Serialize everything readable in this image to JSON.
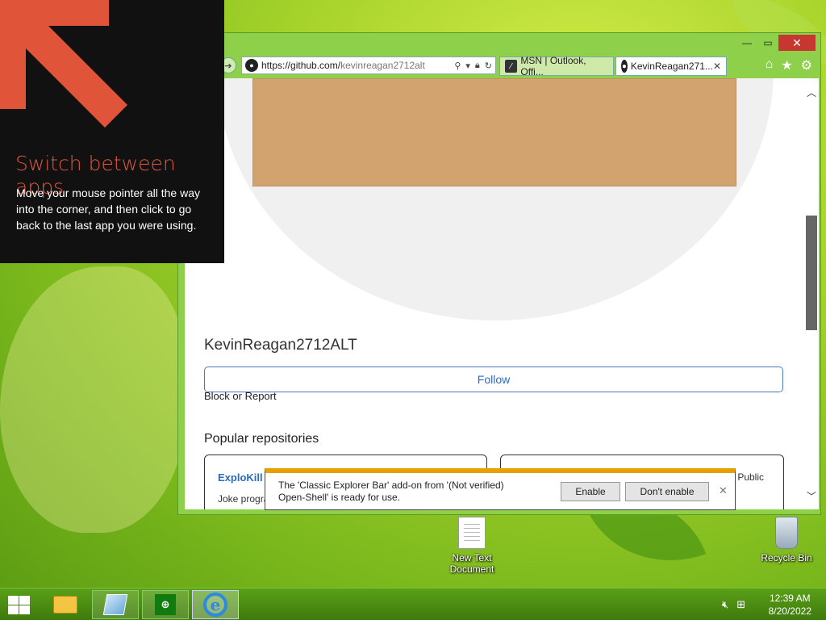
{
  "tip": {
    "title": "Switch between apps",
    "body": "Move your mouse pointer all the way into the corner, and then click to go back to the last app you were using."
  },
  "browser": {
    "address": {
      "prefix": "https://github.com/",
      "host": "kevinreagan2712alt"
    },
    "tabs": [
      {
        "label": "MSN | Outlook, Offi...",
        "icon": "msn-icon"
      },
      {
        "label": "KevinReagan271...",
        "icon": "github-icon"
      }
    ],
    "window_controls": {
      "minimize": "—",
      "maximize": "▭",
      "close": "✕"
    }
  },
  "profile": {
    "username": "KevinReagan2712ALT",
    "follow_label": "Follow",
    "block_label": "Block or Report",
    "popular_heading": "Popular repositories",
    "repos": [
      {
        "name": "ExploKill",
        "description": "Joke progra"
      },
      {
        "name": "",
        "visibility": "Public"
      }
    ]
  },
  "notification": {
    "line1": "The 'Classic Explorer Bar' add-on from '(Not verified)",
    "line2": "Open-Shell' is ready for use.",
    "enable_label": "Enable",
    "dont_enable_label": "Don't enable"
  },
  "desktop": {
    "icons": [
      {
        "label": "New Text Document"
      },
      {
        "label": "Recycle Bin"
      }
    ]
  },
  "taskbar": {
    "time": "12:39 AM",
    "date": "8/20/2022"
  },
  "colors": {
    "accent": "#e0553a",
    "link": "#2b6cc0",
    "notify_bar": "#e8a000",
    "avatar": "#d2a36f"
  }
}
